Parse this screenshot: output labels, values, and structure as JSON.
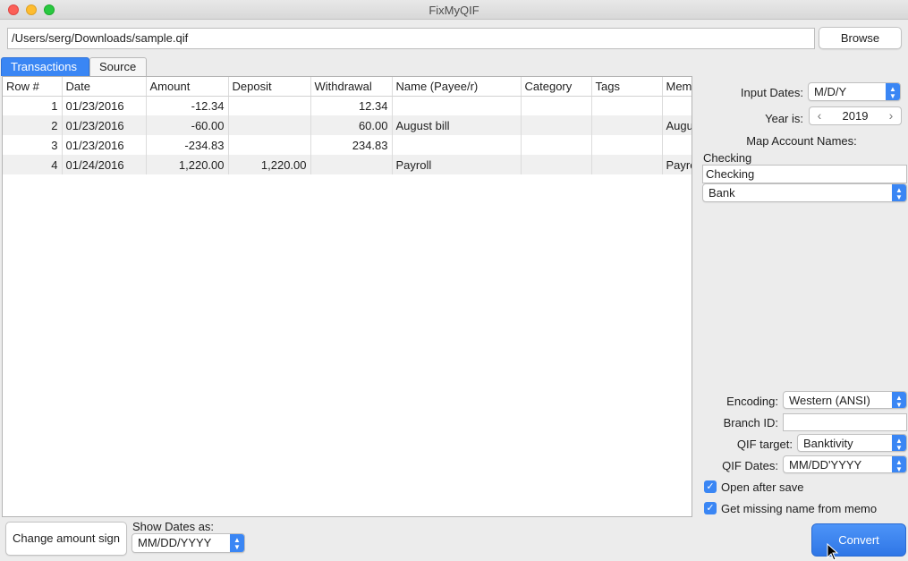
{
  "window": {
    "title": "FixMyQIF"
  },
  "file": {
    "path": "/Users/serg/Downloads/sample.qif",
    "browse_label": "Browse"
  },
  "tabs": [
    {
      "label": "Transactions",
      "active": true
    },
    {
      "label": "Source",
      "active": false
    }
  ],
  "table": {
    "columns": [
      "Row #",
      "Date",
      "Amount",
      "Deposit",
      "Withdrawal",
      "Name (Payee/r)",
      "Category",
      "Tags",
      "Mem"
    ],
    "rows": [
      [
        "1",
        "01/23/2016",
        "-12.34",
        "",
        "12.34",
        "",
        "",
        "",
        ""
      ],
      [
        "2",
        "01/23/2016",
        "-60.00",
        "",
        "60.00",
        "August bill",
        "",
        "",
        "Augu"
      ],
      [
        "3",
        "01/23/2016",
        "-234.83",
        "",
        "234.83",
        "",
        "",
        "",
        ""
      ],
      [
        "4",
        "01/24/2016",
        "1,220.00",
        "1,220.00",
        "",
        "Payroll",
        "",
        "",
        "Payro"
      ]
    ]
  },
  "settings": {
    "input_dates_label": "Input Dates:",
    "input_dates_value": "M/D/Y",
    "year_label": "Year is:",
    "year_value": "2019",
    "map_accounts_label": "Map Account Names:",
    "account_name": "Checking",
    "account_field_value": "Checking",
    "account_type_value": "Bank",
    "encoding_label": "Encoding:",
    "encoding_value": "Western (ANSI)",
    "branch_label": "Branch ID:",
    "branch_value": "",
    "qif_target_label": "QIF target:",
    "qif_target_value": "Banktivity",
    "qif_dates_label": "QIF Dates:",
    "qif_dates_value": "MM/DD'YYYY",
    "open_after_save_label": "Open after save",
    "open_after_save_checked": true,
    "missing_name_label": "Get missing name from memo",
    "missing_name_checked": true
  },
  "bottom": {
    "change_sign_label": "Change amount sign",
    "show_dates_label": "Show Dates as:",
    "show_dates_value": "MM/DD/YYYY",
    "convert_label": "Convert"
  },
  "colors": {
    "accent": "#3a86f4"
  }
}
